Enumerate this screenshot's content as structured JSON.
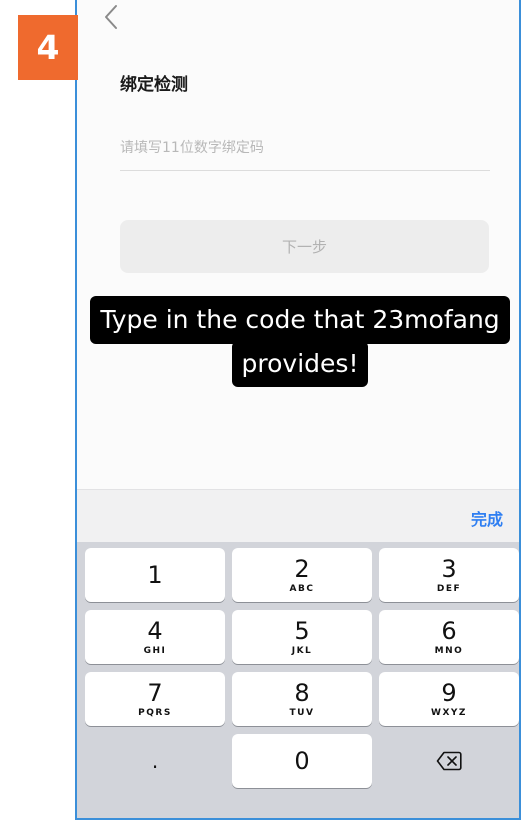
{
  "step_badge": "4",
  "header": {
    "title": "绑定检测"
  },
  "form": {
    "code_placeholder": "请填写11位数字绑定码",
    "next_label": "下一步"
  },
  "overlay": {
    "line1": "Type in the code that 23mofang",
    "line2": "provides!"
  },
  "keyboard": {
    "done_label": "完成",
    "keys": [
      {
        "digit": "1",
        "letters": ""
      },
      {
        "digit": "2",
        "letters": "ABC"
      },
      {
        "digit": "3",
        "letters": "DEF"
      },
      {
        "digit": "4",
        "letters": "GHI"
      },
      {
        "digit": "5",
        "letters": "JKL"
      },
      {
        "digit": "6",
        "letters": "MNO"
      },
      {
        "digit": "7",
        "letters": "PQRS"
      },
      {
        "digit": "8",
        "letters": "TUV"
      },
      {
        "digit": "9",
        "letters": "WXYZ"
      },
      {
        "symbol": "."
      },
      {
        "digit": "0",
        "letters": ""
      }
    ]
  },
  "colors": {
    "accent": "#2f7ff2",
    "badge": "#ef6a2e",
    "frame_border": "#3b8fd9"
  }
}
